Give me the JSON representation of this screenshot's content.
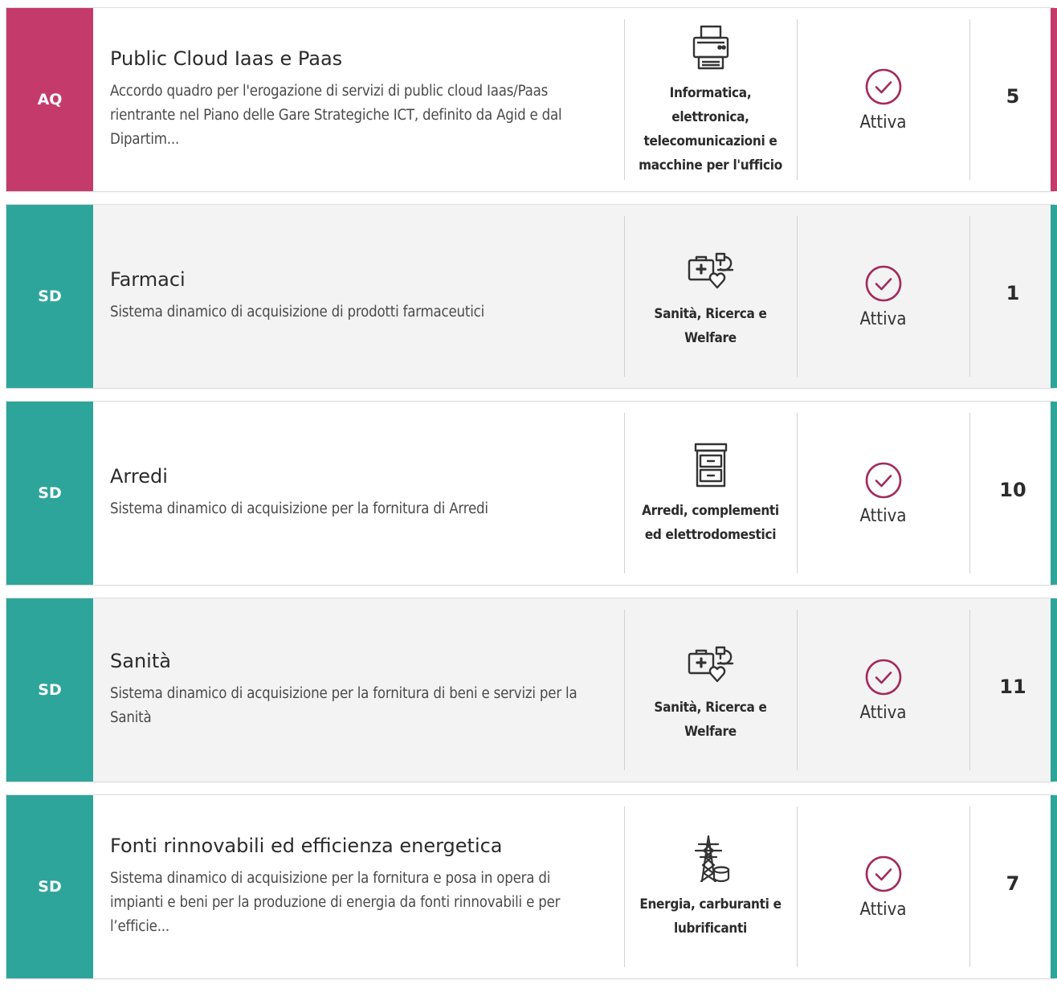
{
  "colors": {
    "aq": "#c43b6b",
    "sd": "#2ea59b",
    "status_icon": "#a22a5e"
  },
  "cards": [
    {
      "badge": "AQ",
      "accent": "aq",
      "title": "Public Cloud Iaas e Paas",
      "description": "Accordo quadro per l'erogazione di servizi di public cloud Iaas/Paas rientrante nel Piano delle Gare Strategiche ICT, definito da Agid e dal Dipartim...",
      "category": "Informatica, elettronica, telecomunicazioni e macchine per l'ufficio",
      "category_icon": "printer-icon",
      "status": "Attiva",
      "count": "5"
    },
    {
      "badge": "SD",
      "accent": "sd",
      "title": "Farmaci",
      "description": "Sistema dinamico di acquisizione di prodotti farmaceutici",
      "category": "Sanità, Ricerca e Welfare",
      "category_icon": "health-research-icon",
      "status": "Attiva",
      "count": "1"
    },
    {
      "badge": "SD",
      "accent": "sd",
      "title": "Arredi",
      "description": "Sistema dinamico di acquisizione per la fornitura di Arredi",
      "category": "Arredi, complementi ed elettrodomestici",
      "category_icon": "cabinet-icon",
      "status": "Attiva",
      "count": "10"
    },
    {
      "badge": "SD",
      "accent": "sd",
      "title": "Sanità",
      "description": "Sistema dinamico di acquisizione per la fornitura di beni e servizi per la Sanità",
      "category": "Sanità, Ricerca e Welfare",
      "category_icon": "health-research-icon",
      "status": "Attiva",
      "count": "11"
    },
    {
      "badge": "SD",
      "accent": "sd",
      "title": "Fonti rinnovabili ed efficienza energetica",
      "description": "Sistema dinamico di acquisizione per la fornitura e posa in opera di impianti e beni per la produzione di energia da fonti rinnovabili e per l’efficie...",
      "category": "Energia, carburanti e lubrificanti",
      "category_icon": "power-tower-icon",
      "status": "Attiva",
      "count": "7"
    }
  ]
}
